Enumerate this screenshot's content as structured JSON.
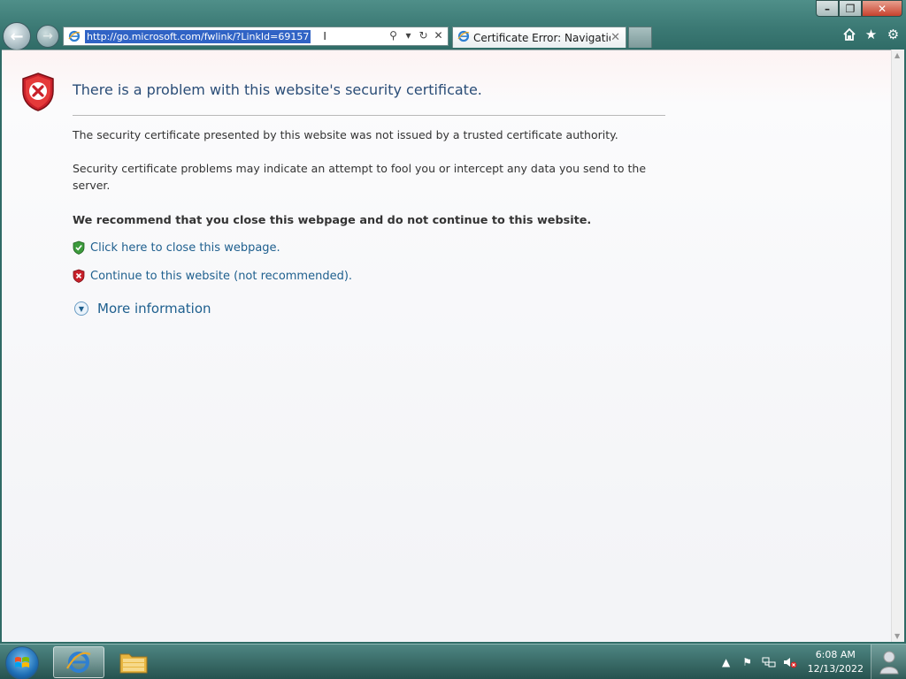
{
  "browser": {
    "address_url": "http://go.microsoft.com/fwlink/?LinkId=69157",
    "tab_title": "Certificate Error: Navigation...",
    "window_controls": [
      "minimize",
      "restore",
      "close"
    ],
    "toolbar_icons": [
      "home-icon",
      "favorites-star-icon",
      "gear-icon"
    ],
    "address_tools": [
      "search-icon",
      "dropdown-icon",
      "refresh-icon",
      "stop-icon"
    ]
  },
  "page": {
    "headline": "There is a problem with this website's security certificate.",
    "paragraph1": "The security certificate presented by this website was not issued by a trusted certificate authority.",
    "paragraph2": "Security certificate problems may indicate an attempt to fool you or intercept any data you send to the server.",
    "recommendation": "We recommend that you close this webpage and do not continue to this website.",
    "link_close": "Click here to close this webpage.",
    "link_continue": "Continue to this website (not recommended).",
    "more_info": "More information"
  },
  "taskbar": {
    "time": "6:08 AM",
    "date": "12/13/2022",
    "pinned": [
      "internet-explorer",
      "windows-explorer"
    ],
    "tray_icons": [
      "show-hidden-icons",
      "action-center-flag-icon",
      "network-icon",
      "volume-muted-icon"
    ]
  },
  "colors": {
    "link": "#1e5f8e",
    "headline": "#2a4d77",
    "shield_red": "#c8202a",
    "shield_green": "#3c9b3c",
    "selection": "#3063c5"
  }
}
